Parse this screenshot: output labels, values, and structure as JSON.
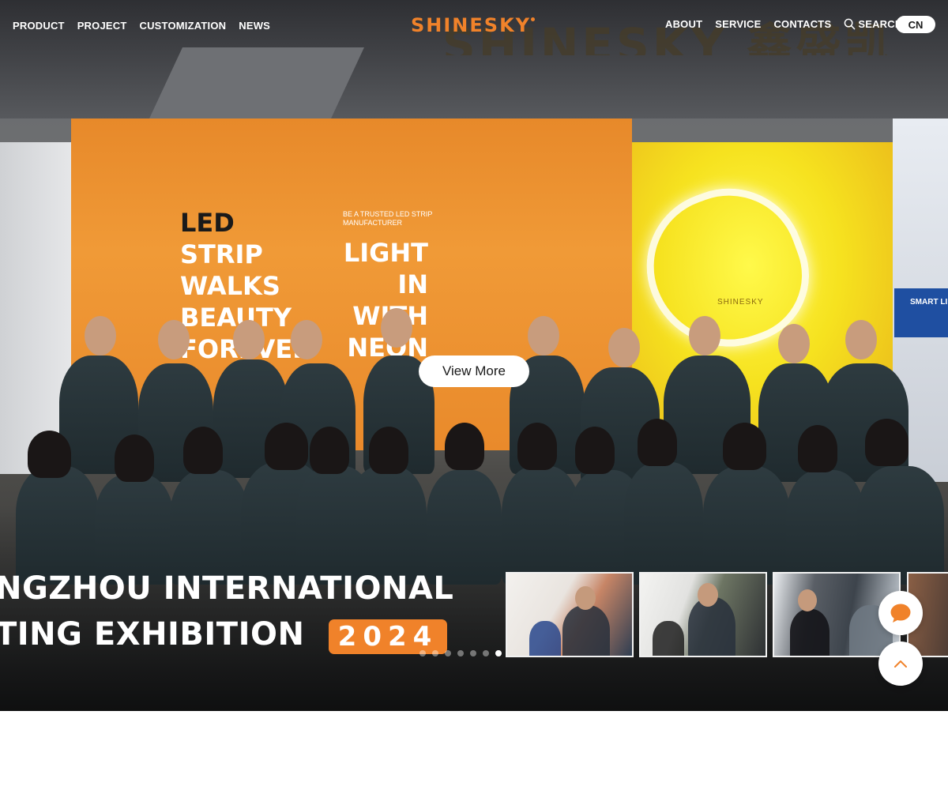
{
  "nav": {
    "left": [
      "PRODUCT",
      "PROJECT",
      "CUSTOMIZATION",
      "NEWS"
    ],
    "right": [
      "ABOUT",
      "SERVICE",
      "CONTACTS"
    ],
    "search_label": "SEARCH",
    "lang_label": "CN"
  },
  "brand": {
    "logo_text": "SHINESKY",
    "accent_color": "#f0822a"
  },
  "hero": {
    "booth_sign": "SHINESKY 鑫盛凯",
    "slogan_left": [
      "LED",
      "STRIP",
      "WALKS",
      "BEAUTY",
      "FOREVER"
    ],
    "slogan_right": [
      "LIGHT",
      "IN",
      "WITH",
      "NEON"
    ],
    "slogan_small": "BE A TRUSTED LED STRIP MANUFACTURER",
    "neon_brand": "SHINESKY",
    "smart_panel": "SMART LI",
    "cta_label": "View More",
    "exhibition_line1": "NGZHOU INTERNATIONAL",
    "exhibition_line2": "TING EXHIBITION",
    "exhibition_year": "2024"
  },
  "carousel": {
    "slide_count": 7,
    "active_index": 7
  },
  "floating": {
    "chat_icon": "chat-bubble-icon",
    "top_icon": "chevron-up-icon"
  }
}
